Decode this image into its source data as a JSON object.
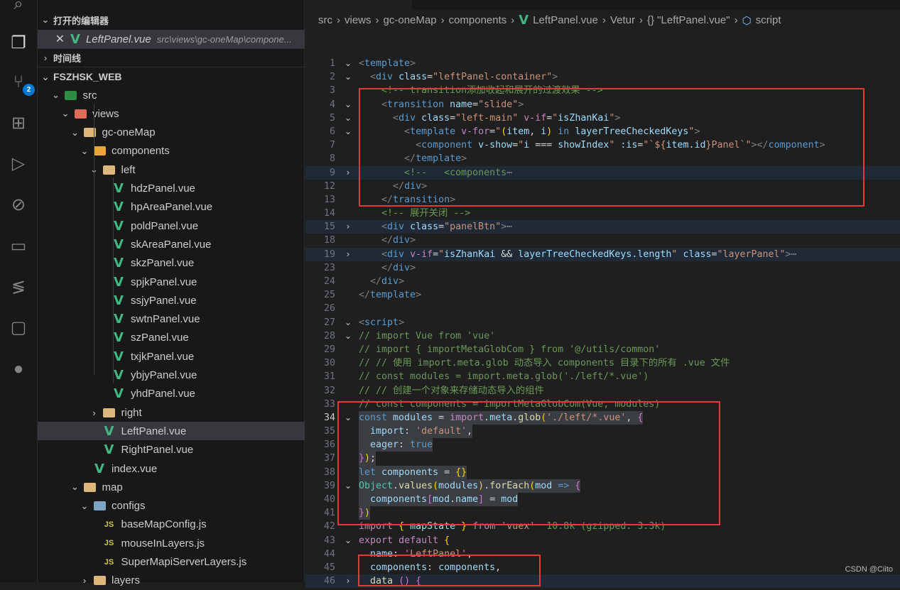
{
  "activity_bar": {
    "items": [
      "search-icon",
      "explorer-icon",
      "source-control-icon",
      "extensions-icon",
      "run-debug-icon",
      "git-graph-icon",
      "folder-icon",
      "remote-icon",
      "chat-icon",
      "github-icon"
    ],
    "source_control_badge": "2"
  },
  "explorer": {
    "open_editors_title": "打开的编辑器",
    "open_file": {
      "name": "LeftPanel.vue",
      "path": "src\\views\\gc-oneMap\\compone..."
    },
    "timeline_title": "时间线",
    "project_title": "FSZHSK_WEB",
    "tree": [
      {
        "label": "src",
        "depth": 1,
        "type": "folder-src",
        "open": true
      },
      {
        "label": "views",
        "depth": 2,
        "type": "folder-views",
        "open": true
      },
      {
        "label": "gc-oneMap",
        "depth": 3,
        "type": "folder",
        "open": true
      },
      {
        "label": "components",
        "depth": 4,
        "type": "folder-components",
        "open": true
      },
      {
        "label": "left",
        "depth": 5,
        "type": "folder",
        "open": true
      },
      {
        "label": "hdzPanel.vue",
        "depth": 6,
        "type": "vue"
      },
      {
        "label": "hpAreaPanel.vue",
        "depth": 6,
        "type": "vue"
      },
      {
        "label": "poldPanel.vue",
        "depth": 6,
        "type": "vue"
      },
      {
        "label": "skAreaPanel.vue",
        "depth": 6,
        "type": "vue"
      },
      {
        "label": "skzPanel.vue",
        "depth": 6,
        "type": "vue"
      },
      {
        "label": "spjkPanel.vue",
        "depth": 6,
        "type": "vue"
      },
      {
        "label": "ssjyPanel.vue",
        "depth": 6,
        "type": "vue"
      },
      {
        "label": "swtnPanel.vue",
        "depth": 6,
        "type": "vue"
      },
      {
        "label": "szPanel.vue",
        "depth": 6,
        "type": "vue"
      },
      {
        "label": "txjkPanel.vue",
        "depth": 6,
        "type": "vue"
      },
      {
        "label": "ybjyPanel.vue",
        "depth": 6,
        "type": "vue"
      },
      {
        "label": "yhdPanel.vue",
        "depth": 6,
        "type": "vue"
      },
      {
        "label": "right",
        "depth": 5,
        "type": "folder",
        "open": false
      },
      {
        "label": "LeftPanel.vue",
        "depth": 5,
        "type": "vue",
        "selected": true
      },
      {
        "label": "RightPanel.vue",
        "depth": 5,
        "type": "vue"
      },
      {
        "label": "index.vue",
        "depth": 4,
        "type": "vue"
      },
      {
        "label": "map",
        "depth": 3,
        "type": "folder",
        "open": true
      },
      {
        "label": "configs",
        "depth": 4,
        "type": "folder-config",
        "open": true
      },
      {
        "label": "baseMapConfig.js",
        "depth": 5,
        "type": "js"
      },
      {
        "label": "mouseInLayers.js",
        "depth": 5,
        "type": "js"
      },
      {
        "label": "SuperMapiServerLayers.js",
        "depth": 5,
        "type": "js"
      },
      {
        "label": "layers",
        "depth": 4,
        "type": "folder",
        "open": false
      }
    ]
  },
  "breadcrumb": [
    "src",
    "views",
    "gc-oneMap",
    "components",
    "LeftPanel.vue",
    "Vetur",
    "{} \"LeftPanel.vue\"",
    "script"
  ],
  "code": [
    {
      "n": "1",
      "fold": "v",
      "t": [
        [
          "br",
          "<"
        ],
        [
          "tag",
          "template"
        ],
        [
          "br",
          ">"
        ]
      ]
    },
    {
      "n": "2",
      "fold": "v",
      "t": [
        [
          "pl",
          "  "
        ],
        [
          "br",
          "<"
        ],
        [
          "tag",
          "div"
        ],
        [
          "pl",
          " "
        ],
        [
          "at",
          "class"
        ],
        [
          "pl",
          "="
        ],
        [
          "str",
          "\"leftPanel-container\""
        ],
        [
          "br",
          ">"
        ]
      ]
    },
    {
      "n": "3",
      "t": [
        [
          "pl",
          "    "
        ],
        [
          "cm",
          "<!-- transition添加收起和展开的过渡效果 -->"
        ]
      ]
    },
    {
      "n": "4",
      "fold": "v",
      "t": [
        [
          "pl",
          "    "
        ],
        [
          "br",
          "<"
        ],
        [
          "tag",
          "transition"
        ],
        [
          "pl",
          " "
        ],
        [
          "at",
          "name"
        ],
        [
          "pl",
          "="
        ],
        [
          "str",
          "\"slide\""
        ],
        [
          "br",
          ">"
        ]
      ]
    },
    {
      "n": "5",
      "fold": "v",
      "t": [
        [
          "pl",
          "      "
        ],
        [
          "br",
          "<"
        ],
        [
          "tag",
          "div"
        ],
        [
          "pl",
          " "
        ],
        [
          "at",
          "class"
        ],
        [
          "pl",
          "="
        ],
        [
          "str",
          "\"left-main\""
        ],
        [
          "pl",
          " "
        ],
        [
          "ctl",
          "v-if"
        ],
        [
          "pl",
          "="
        ],
        [
          "str",
          "\""
        ],
        [
          "var",
          "isZhanKai"
        ],
        [
          "str",
          "\""
        ],
        [
          "br",
          ">"
        ]
      ]
    },
    {
      "n": "6",
      "fold": "v",
      "t": [
        [
          "pl",
          "        "
        ],
        [
          "br",
          "<"
        ],
        [
          "tag",
          "template"
        ],
        [
          "pl",
          " "
        ],
        [
          "ctl",
          "v-for"
        ],
        [
          "pl",
          "="
        ],
        [
          "str",
          "\""
        ],
        [
          "y",
          "("
        ],
        [
          "var",
          "item"
        ],
        [
          "pl",
          ", "
        ],
        [
          "var",
          "i"
        ],
        [
          "y",
          ")"
        ],
        [
          "kw",
          " in "
        ],
        [
          "var",
          "layerTreeCheckedKeys"
        ],
        [
          "str",
          "\""
        ],
        [
          "br",
          ">"
        ]
      ]
    },
    {
      "n": "7",
      "t": [
        [
          "pl",
          "          "
        ],
        [
          "br",
          "<"
        ],
        [
          "tag",
          "component"
        ],
        [
          "pl",
          " "
        ],
        [
          "at",
          "v-show"
        ],
        [
          "pl",
          "="
        ],
        [
          "str",
          "\""
        ],
        [
          "var",
          "i"
        ],
        [
          "pl",
          " === "
        ],
        [
          "var",
          "showIndex"
        ],
        [
          "str",
          "\""
        ],
        [
          "pl",
          " "
        ],
        [
          "at",
          ":is"
        ],
        [
          "pl",
          "="
        ],
        [
          "str",
          "\"`${"
        ],
        [
          "var",
          "item.id"
        ],
        [
          "str",
          "}Panel`\""
        ],
        [
          "br",
          "></"
        ],
        [
          "tag",
          "component"
        ],
        [
          "br",
          ">"
        ]
      ]
    },
    {
      "n": "8",
      "t": [
        [
          "pl",
          "        "
        ],
        [
          "br",
          "</"
        ],
        [
          "tag",
          "template"
        ],
        [
          "br",
          ">"
        ]
      ]
    },
    {
      "n": "9",
      "fold": ">",
      "hl": true,
      "t": [
        [
          "pl",
          "        "
        ],
        [
          "cm",
          "<!--   <components"
        ],
        [
          "el",
          "⋯"
        ]
      ]
    },
    {
      "n": "12",
      "t": [
        [
          "pl",
          "      "
        ],
        [
          "br",
          "</"
        ],
        [
          "tag",
          "div"
        ],
        [
          "br",
          ">"
        ]
      ]
    },
    {
      "n": "13",
      "t": [
        [
          "pl",
          "    "
        ],
        [
          "br",
          "</"
        ],
        [
          "tag",
          "transition"
        ],
        [
          "br",
          ">"
        ]
      ]
    },
    {
      "n": "14",
      "t": [
        [
          "pl",
          "    "
        ],
        [
          "cm",
          "<!-- 展开关闭 -->"
        ]
      ]
    },
    {
      "n": "15",
      "fold": ">",
      "hl": true,
      "t": [
        [
          "pl",
          "    "
        ],
        [
          "br",
          "<"
        ],
        [
          "tag",
          "div"
        ],
        [
          "pl",
          " "
        ],
        [
          "at",
          "class"
        ],
        [
          "pl",
          "="
        ],
        [
          "str",
          "\"panelBtn\""
        ],
        [
          "br",
          ">"
        ],
        [
          "el",
          "⋯"
        ]
      ]
    },
    {
      "n": "18",
      "t": [
        [
          "pl",
          "    "
        ],
        [
          "br",
          "</"
        ],
        [
          "tag",
          "div"
        ],
        [
          "br",
          ">"
        ]
      ]
    },
    {
      "n": "19",
      "fold": ">",
      "hl": true,
      "t": [
        [
          "pl",
          "    "
        ],
        [
          "br",
          "<"
        ],
        [
          "tag",
          "div"
        ],
        [
          "pl",
          " "
        ],
        [
          "ctl",
          "v-if"
        ],
        [
          "pl",
          "="
        ],
        [
          "str",
          "\""
        ],
        [
          "var",
          "isZhanKai"
        ],
        [
          "pl",
          " && "
        ],
        [
          "var",
          "layerTreeCheckedKeys.length"
        ],
        [
          "str",
          "\""
        ],
        [
          "pl",
          " "
        ],
        [
          "at",
          "class"
        ],
        [
          "pl",
          "="
        ],
        [
          "str",
          "\"layerPanel\""
        ],
        [
          "br",
          ">"
        ],
        [
          "el",
          "⋯"
        ]
      ]
    },
    {
      "n": "23",
      "t": [
        [
          "pl",
          "    "
        ],
        [
          "br",
          "</"
        ],
        [
          "tag",
          "div"
        ],
        [
          "br",
          ">"
        ]
      ]
    },
    {
      "n": "24",
      "t": [
        [
          "pl",
          "  "
        ],
        [
          "br",
          "</"
        ],
        [
          "tag",
          "div"
        ],
        [
          "br",
          ">"
        ]
      ]
    },
    {
      "n": "25",
      "t": [
        [
          "br",
          "</"
        ],
        [
          "tag",
          "template"
        ],
        [
          "br",
          ">"
        ]
      ]
    },
    {
      "n": "26",
      "t": []
    },
    {
      "n": "27",
      "fold": "v",
      "t": [
        [
          "br",
          "<"
        ],
        [
          "tag",
          "script"
        ],
        [
          "br",
          ">"
        ]
      ]
    },
    {
      "n": "28",
      "fold": "v",
      "t": [
        [
          "cm",
          "// import Vue from 'vue'"
        ]
      ]
    },
    {
      "n": "29",
      "t": [
        [
          "cm",
          "// import { importMetaGlobCom } from '@/utils/common'"
        ]
      ]
    },
    {
      "n": "30",
      "t": [
        [
          "cm",
          "// // 使用 import.meta.glob 动态导入 components 目录下的所有 .vue 文件"
        ]
      ]
    },
    {
      "n": "31",
      "t": [
        [
          "cm",
          "// const modules = import.meta.glob('./left/*.vue')"
        ]
      ]
    },
    {
      "n": "32",
      "t": [
        [
          "cm",
          "// // 创建一个对象来存储动态导入的组件"
        ]
      ]
    },
    {
      "n": "33",
      "t": [
        [
          "cm",
          "// const components = importMetaGlobCom(Vue, modules)"
        ]
      ]
    },
    {
      "n": "34",
      "fold": "v",
      "sel": true,
      "cur": true,
      "t": [
        [
          "kw",
          "const"
        ],
        [
          "pl",
          " "
        ],
        [
          "var",
          "modules"
        ],
        [
          "pl",
          " = "
        ],
        [
          "ctl",
          "import"
        ],
        [
          "pl",
          "."
        ],
        [
          "var",
          "meta"
        ],
        [
          "pl",
          "."
        ],
        [
          "fn",
          "glob"
        ],
        [
          "y",
          "("
        ],
        [
          "str",
          "'./left/*.vue'"
        ],
        [
          "pl",
          ", "
        ],
        [
          "p",
          "{"
        ]
      ]
    },
    {
      "n": "35",
      "sel": true,
      "t": [
        [
          "pl",
          "  "
        ],
        [
          "var",
          "import"
        ],
        [
          "pl",
          ": "
        ],
        [
          "str",
          "'default'"
        ],
        [
          "pl",
          ","
        ]
      ]
    },
    {
      "n": "36",
      "sel": true,
      "t": [
        [
          "pl",
          "  "
        ],
        [
          "var",
          "eager"
        ],
        [
          "pl",
          ": "
        ],
        [
          "kw",
          "true"
        ]
      ]
    },
    {
      "n": "37",
      "sel": true,
      "t": [
        [
          "p",
          "}"
        ],
        [
          "y",
          ")"
        ],
        [
          "pl",
          ";"
        ]
      ]
    },
    {
      "n": "38",
      "sel": true,
      "t": [
        [
          "kw",
          "let"
        ],
        [
          "pl",
          " "
        ],
        [
          "var",
          "components"
        ],
        [
          "pl",
          " = "
        ],
        [
          "y",
          "{}"
        ]
      ]
    },
    {
      "n": "39",
      "fold": "v",
      "sel": true,
      "t": [
        [
          "cls",
          "Object"
        ],
        [
          "pl",
          "."
        ],
        [
          "fn",
          "values"
        ],
        [
          "y",
          "("
        ],
        [
          "var",
          "modules"
        ],
        [
          "y",
          ")"
        ],
        [
          "pl",
          "."
        ],
        [
          "fn",
          "forEach"
        ],
        [
          "y",
          "("
        ],
        [
          "var",
          "mod"
        ],
        [
          "pl",
          " "
        ],
        [
          "kw",
          "=>"
        ],
        [
          "pl",
          " "
        ],
        [
          "p",
          "{"
        ]
      ]
    },
    {
      "n": "40",
      "sel": true,
      "t": [
        [
          "pl",
          "  "
        ],
        [
          "var",
          "components"
        ],
        [
          "p",
          "["
        ],
        [
          "var",
          "mod"
        ],
        [
          "pl",
          "."
        ],
        [
          "var",
          "name"
        ],
        [
          "p",
          "]"
        ],
        [
          "pl",
          " = "
        ],
        [
          "var",
          "mod"
        ]
      ]
    },
    {
      "n": "41",
      "sel": true,
      "t": [
        [
          "p",
          "}"
        ],
        [
          "y",
          ")"
        ]
      ]
    },
    {
      "n": "42",
      "t": [
        [
          "ctl",
          "import"
        ],
        [
          "pl",
          " "
        ],
        [
          "y",
          "{"
        ],
        [
          "pl",
          " "
        ],
        [
          "var",
          "mapState"
        ],
        [
          "pl",
          " "
        ],
        [
          "y",
          "}"
        ],
        [
          "pl",
          " "
        ],
        [
          "ctl",
          "from"
        ],
        [
          "pl",
          " "
        ],
        [
          "str",
          "'vuex'"
        ],
        [
          "cm",
          "  10.8k (gzipped: 3.3k)"
        ]
      ]
    },
    {
      "n": "43",
      "fold": "v",
      "t": [
        [
          "ctl",
          "export"
        ],
        [
          "pl",
          " "
        ],
        [
          "ctl",
          "default"
        ],
        [
          "pl",
          " "
        ],
        [
          "y",
          "{"
        ]
      ]
    },
    {
      "n": "44",
      "t": [
        [
          "pl",
          "  "
        ],
        [
          "var",
          "name"
        ],
        [
          "pl",
          ": "
        ],
        [
          "str",
          "'LeftPanel'"
        ],
        [
          "pl",
          ","
        ]
      ]
    },
    {
      "n": "45",
      "t": [
        [
          "pl",
          "  "
        ],
        [
          "var",
          "components"
        ],
        [
          "pl",
          ": "
        ],
        [
          "var",
          "components"
        ],
        [
          "pl",
          ","
        ]
      ]
    },
    {
      "n": "46",
      "fold": ">",
      "hl": true,
      "t": [
        [
          "pl",
          "  "
        ],
        [
          "fn",
          "data"
        ],
        [
          "pl",
          " "
        ],
        [
          "p",
          "()"
        ],
        [
          "pl",
          " "
        ],
        [
          "p",
          "{"
        ]
      ]
    }
  ],
  "watermark": "CSDN @Ciito"
}
